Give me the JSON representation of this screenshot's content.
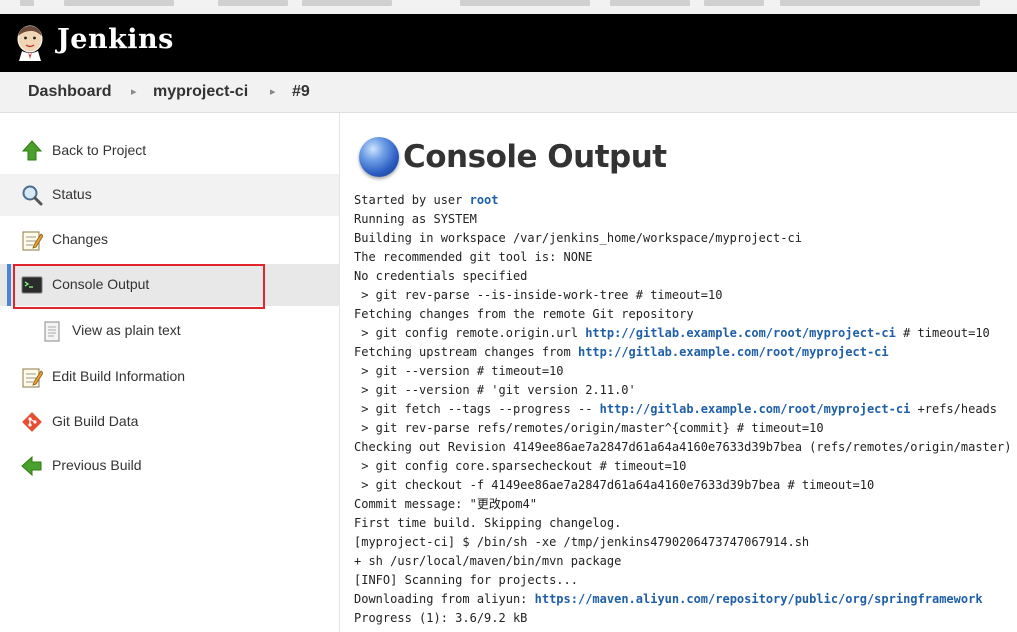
{
  "header": {
    "brand": "Jenkins"
  },
  "breadcrumb": {
    "items": [
      "Dashboard",
      "myproject-ci",
      "#9"
    ]
  },
  "sidebar": {
    "items": [
      {
        "label": "Back to Project",
        "icon": "green-up-arrow-icon"
      },
      {
        "label": "Status",
        "icon": "magnifier-icon"
      },
      {
        "label": "Changes",
        "icon": "notepad-icon"
      },
      {
        "label": "Console Output",
        "icon": "terminal-icon",
        "active": true
      },
      {
        "label": "View as plain text",
        "icon": "document-icon"
      },
      {
        "label": "Edit Build Information",
        "icon": "notepad-icon"
      },
      {
        "label": "Git Build Data",
        "icon": "git-icon"
      },
      {
        "label": "Previous Build",
        "icon": "green-left-arrow-icon"
      }
    ]
  },
  "main": {
    "title": "Console Output",
    "console": {
      "l1_pre": "Started by user ",
      "l1_link": "root",
      "l2": "Running as SYSTEM",
      "l3": "Building in workspace /var/jenkins_home/workspace/myproject-ci",
      "l4": "The recommended git tool is: NONE",
      "l5": "No credentials specified",
      "l6": " > git rev-parse --is-inside-work-tree # timeout=10",
      "l7": "Fetching changes from the remote Git repository",
      "l8_pre": " > git config remote.origin.url ",
      "l8_link": "http://gitlab.example.com/root/myproject-ci",
      "l8_post": " # timeout=10",
      "l9_pre": "Fetching upstream changes from ",
      "l9_link": "http://gitlab.example.com/root/myproject-ci",
      "l10": " > git --version # timeout=10",
      "l11": " > git --version # 'git version 2.11.0'",
      "l12_pre": " > git fetch --tags --progress -- ",
      "l12_link": "http://gitlab.example.com/root/myproject-ci",
      "l12_post": " +refs/heads",
      "l13": " > git rev-parse refs/remotes/origin/master^{commit} # timeout=10",
      "l14": "Checking out Revision 4149ee86ae7a2847d61a64a4160e7633d39b7bea (refs/remotes/origin/master)",
      "l15": " > git config core.sparsecheckout # timeout=10",
      "l16": " > git checkout -f 4149ee86ae7a2847d61a64a4160e7633d39b7bea # timeout=10",
      "l17": "Commit message: \"更改pom4\"",
      "l18": "First time build. Skipping changelog.",
      "l19": "[myproject-ci] $ /bin/sh -xe /tmp/jenkins4790206473747067914.sh",
      "l20": "+ sh /usr/local/maven/bin/mvn package",
      "l21": "[INFO] Scanning for projects...",
      "l22_pre": "Downloading from aliyun: ",
      "l22_link": "https://maven.aliyun.com/repository/public/org/springframework",
      "l23": "Progress (1): 3.6/9.2 kB"
    }
  }
}
